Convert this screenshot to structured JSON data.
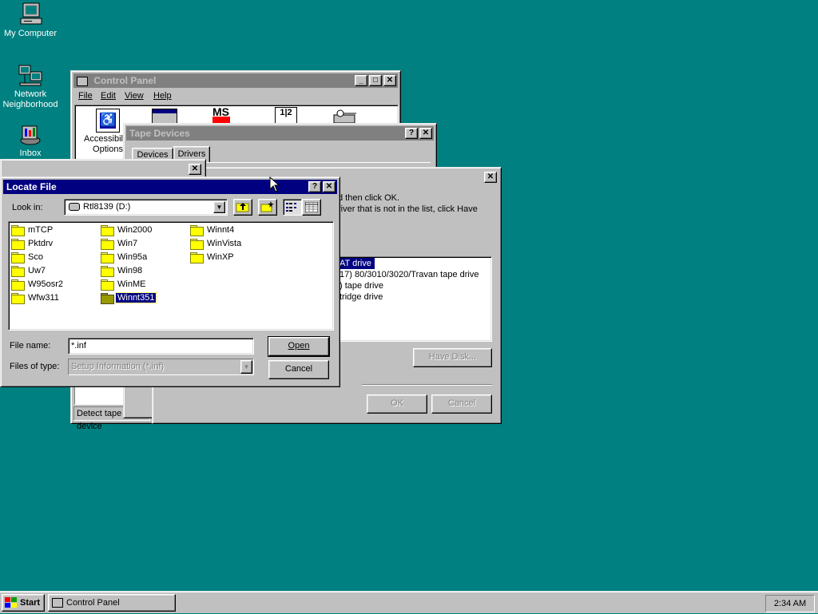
{
  "desktop": {
    "icons": [
      {
        "label": "My Computer"
      },
      {
        "label": "Network Neighborhood"
      },
      {
        "label": "Inbox"
      }
    ]
  },
  "control_panel": {
    "title": "Control Panel",
    "menu": [
      "File",
      "Edit",
      "View",
      "Help"
    ],
    "items": [
      {
        "label": "Accessibility Options"
      }
    ],
    "status": "Detect tape device"
  },
  "tape_devices": {
    "title": "Tape Devices",
    "tabs": [
      "Devices",
      "Drivers"
    ]
  },
  "install_driver": {
    "text_line1": "d then click OK.",
    "text_line2": "river that is not in the list, click Have",
    "list": [
      {
        "label": "AT drive",
        "selected": true
      },
      {
        "label": "17) 80/3010/3020/Travan tape drive",
        "selected": false
      },
      {
        "label": ") tape drive",
        "selected": false
      },
      {
        "label": "tridge drive",
        "selected": false
      }
    ],
    "have_disk": "Have Disk...",
    "ok": "OK",
    "cancel": "Cancel"
  },
  "locate_file": {
    "title": "Locate File",
    "look_in_label": "Look in:",
    "look_in_value": "Rtl8139 (D:)",
    "folders": [
      {
        "name": "mTCP"
      },
      {
        "name": "Pktdrv"
      },
      {
        "name": "Sco"
      },
      {
        "name": "Uw7"
      },
      {
        "name": "W95osr2"
      },
      {
        "name": "Wfw311"
      },
      {
        "name": "Win2000"
      },
      {
        "name": "Win7"
      },
      {
        "name": "Win95a"
      },
      {
        "name": "Win98"
      },
      {
        "name": "WinME"
      },
      {
        "name": "Winnt351"
      },
      {
        "name": "Winnt4"
      },
      {
        "name": "WinVista"
      },
      {
        "name": "WinXP"
      }
    ],
    "selected_folder": "Winnt351",
    "file_name_label": "File name:",
    "file_name_value": "*.inf",
    "files_of_type_label": "Files of type:",
    "files_of_type_value": "Setup Information (*.inf)",
    "open_label": "Open",
    "cancel_label": "Cancel"
  },
  "taskbar": {
    "start_label": "Start",
    "task_label": "Control Panel",
    "clock": "2:34 AM"
  },
  "colors": {
    "desktop": "#008080",
    "active_title": "#000080",
    "inactive_title": "#808080",
    "face": "#c0c0c0"
  }
}
